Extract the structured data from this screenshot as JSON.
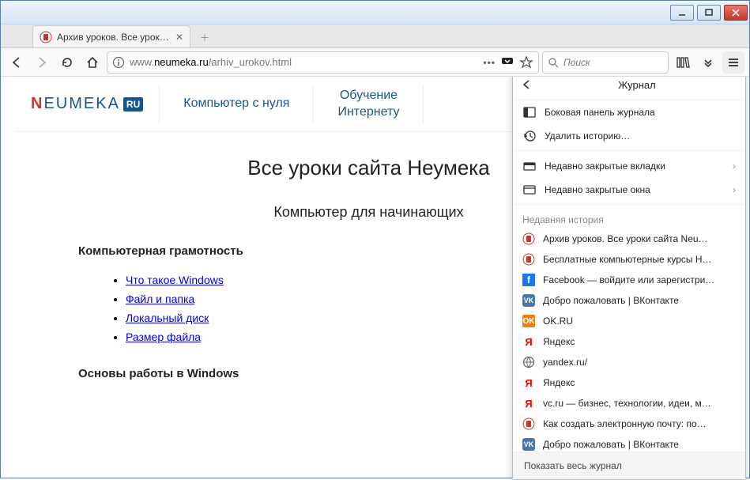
{
  "tab": {
    "title": "Архив уроков. Все уроки сайт"
  },
  "address": {
    "prefix": "www.",
    "domain": "neumeka.ru",
    "path": "/arhiv_urokov.html"
  },
  "search": {
    "placeholder": "Поиск"
  },
  "page": {
    "logo": {
      "text1": "N",
      "text2": "EUMEKA",
      "badge": "RU"
    },
    "nav1": "Компьютер с нуля",
    "nav2a": "Обучение",
    "nav2b": "Интернету",
    "h1": "Все уроки сайта Неумека",
    "h2": "Компьютер для начинающих",
    "section1": "Компьютерная грамотность",
    "links": [
      "Что такое Windows",
      "Файл и папка",
      "Локальный диск",
      "Размер файла"
    ],
    "section2": "Основы работы в Windows"
  },
  "history": {
    "title": "Журнал",
    "sidebar": "Боковая панель журнала",
    "clear": "Удалить историю…",
    "recent_tabs": "Недавно закрытые вкладки",
    "recent_windows": "Недавно закрытые окна",
    "section": "Недавняя история",
    "items": [
      {
        "icon": "neu",
        "text": "Архив уроков. Все уроки сайта Neu…"
      },
      {
        "icon": "neu",
        "text": "Бесплатные компьютерные курсы Н…"
      },
      {
        "icon": "fb",
        "text": "Facebook — войдите или зарегистри…"
      },
      {
        "icon": "vk",
        "text": "Добро пожаловать | ВКонтакте"
      },
      {
        "icon": "ok",
        "text": "OK.RU"
      },
      {
        "icon": "ya",
        "text": "Яндекс"
      },
      {
        "icon": "gl",
        "text": "yandex.ru/"
      },
      {
        "icon": "ya",
        "text": "Яндекс"
      },
      {
        "icon": "ya",
        "text": "vc.ru — бизнес, технологии, идеи, м…"
      },
      {
        "icon": "neu",
        "text": "Как создать электронную почту: по…"
      },
      {
        "icon": "vk",
        "text": "Добро пожаловать | ВКонтакте"
      }
    ],
    "footer": "Показать весь журнал"
  }
}
